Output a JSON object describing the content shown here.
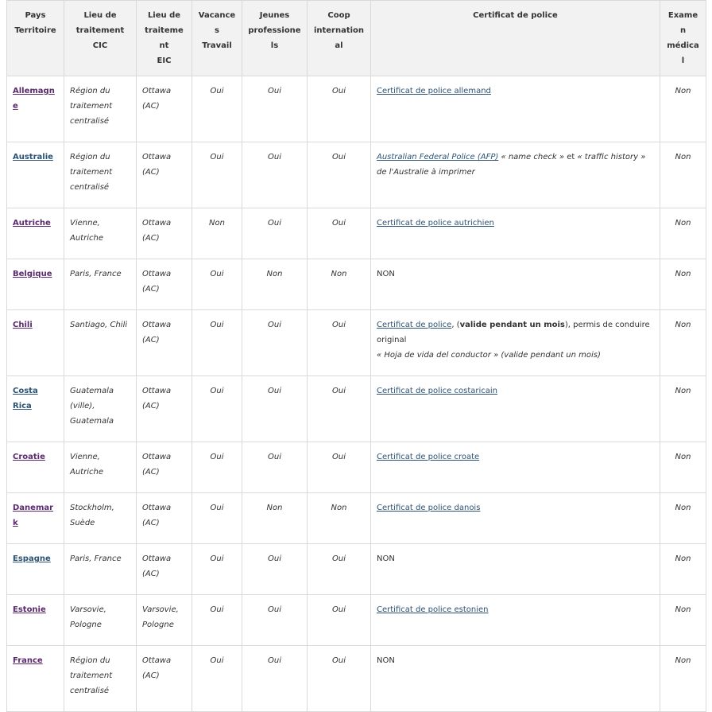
{
  "headers": {
    "pays": [
      "Pays",
      "Territoire"
    ],
    "cic": [
      "Lieu de",
      "traitement",
      "CIC"
    ],
    "eic": [
      "Lieu de",
      "traitement",
      "EIC"
    ],
    "vacances": [
      "Vacances",
      "Travail"
    ],
    "jeunes": [
      "Jeunes",
      "professionels"
    ],
    "coop": [
      "Coop",
      "international"
    ],
    "certificat": "Certificat de police",
    "examen": [
      "Examen",
      "médical"
    ]
  },
  "rows": [
    {
      "country": "Allemagne",
      "cic": "Région du traitement centralisé",
      "eic": "Ottawa (AC)",
      "vt": "Oui",
      "jp": "Oui",
      "ci": "Oui",
      "cert_link": "Certificat de police allemand",
      "exam": "Non"
    },
    {
      "country": "Australie",
      "cic": "Région du traitement centralisé",
      "eic": "Ottawa (AC)",
      "vt": "Oui",
      "jp": "Oui",
      "ci": "Oui",
      "cert_link": "Australian Federal Police (AFP)",
      "cert_text1": " « name check » ",
      "cert_text2": "et",
      "cert_text3": " « traffic history » de l'Australie à imprimer",
      "exam": "Non"
    },
    {
      "country": "Autriche",
      "cic": "Vienne, Autriche",
      "eic": "Ottawa (AC)",
      "vt": "Non",
      "jp": "Oui",
      "ci": "Oui",
      "cert_link": "Certificat de police autrichien",
      "exam": "Non"
    },
    {
      "country": "Belgique",
      "cic": "Paris, France",
      "eic": "Ottawa (AC)",
      "vt": "Oui",
      "jp": "Non",
      "ci": "Non",
      "cert_plain": "NON",
      "exam": "Non"
    },
    {
      "country": "Chili",
      "cic": "Santiago, Chili",
      "eic": "Ottawa (AC)",
      "vt": "Oui",
      "jp": "Oui",
      "ci": "Oui",
      "cert_link": "Certificat de police",
      "cert_text1": ", (",
      "cert_bold": "valide pendant un mois",
      "cert_text2": "), permis de conduire original",
      "cert_text3": "« Hoja de vida del conductor » (valide pendant un mois)",
      "exam": "Non"
    },
    {
      "country": "Costa Rica",
      "cic": "Guatemala (ville), Guatemala",
      "eic": "Ottawa (AC)",
      "vt": "Oui",
      "jp": "Oui",
      "ci": "Oui",
      "cert_link": "Certificat de police costaricain",
      "exam": "Non"
    },
    {
      "country": "Croatie",
      "cic": "Vienne, Autriche",
      "eic": "Ottawa (AC)",
      "vt": "Oui",
      "jp": "Oui",
      "ci": "Oui",
      "cert_link": "Certificat de police croate",
      "exam": "Non"
    },
    {
      "country": "Danemark",
      "cic": "Stockholm, Suède",
      "eic": "Ottawa (AC)",
      "vt": "Oui",
      "jp": "Non",
      "ci": "Non",
      "cert_link": "Certificat de police danois",
      "exam": "Non"
    },
    {
      "country": "Espagne",
      "cic": "Paris, France",
      "eic": "Ottawa (AC)",
      "vt": "Oui",
      "jp": "Oui",
      "ci": "Oui",
      "cert_plain": "NON",
      "exam": "Non"
    },
    {
      "country": "Estonie",
      "cic": "Varsovie, Pologne",
      "eic": "Varsovie, Pologne",
      "vt": "Oui",
      "jp": "Oui",
      "ci": "Oui",
      "cert_link": "Certificat de police estonien",
      "exam": "Non"
    },
    {
      "country": "France",
      "cic": "Région du traitement centralisé",
      "eic": "Ottawa (AC)",
      "vt": "Oui",
      "jp": "Oui",
      "ci": "Oui",
      "cert_plain": "NON",
      "exam": "Non"
    }
  ]
}
